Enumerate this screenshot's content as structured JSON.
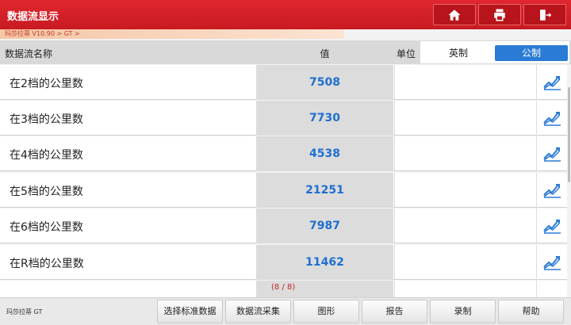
{
  "window": {
    "title": "数据流显示"
  },
  "toolbar": {
    "home_icon": "home-icon",
    "print_icon": "print-icon",
    "exit_icon": "exit-icon"
  },
  "breadcrumb": "玛莎拉蒂 V10.90 > GT >",
  "header": {
    "name_label": "数据流名称",
    "value_label": "值",
    "unit_label": "单位",
    "unit_options": [
      "英制",
      "公制"
    ],
    "unit_selected": "公制"
  },
  "rows": [
    {
      "name": "在2档的公里数",
      "value": "7508"
    },
    {
      "name": "在3档的公里数",
      "value": "7730"
    },
    {
      "name": "在4档的公里数",
      "value": "4538"
    },
    {
      "name": "在5档的公里数",
      "value": "21251"
    },
    {
      "name": "在6档的公里数",
      "value": "7987"
    },
    {
      "name": "在R档的公里数",
      "value": "11462"
    }
  ],
  "counter": "(8 / 8)",
  "footer": {
    "title": "玛莎拉蒂 GT",
    "buttons": [
      "选择标准数据",
      "数据流采集",
      "图形",
      "报告",
      "录制",
      "帮助"
    ]
  },
  "colors": {
    "titlebar": "#d3212a",
    "accent": "#2a7bd6",
    "value_text": "#1e6fd0"
  }
}
